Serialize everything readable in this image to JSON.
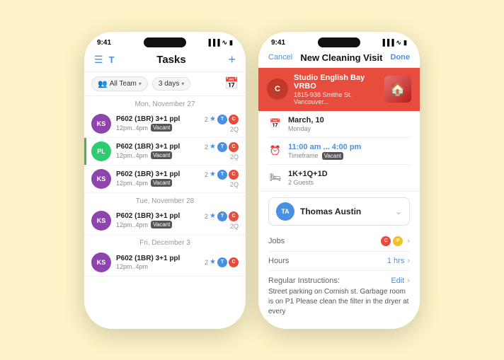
{
  "background": "#fdf3c8",
  "left_phone": {
    "status_time": "9:41",
    "header": {
      "title": "Tasks",
      "add_label": "+"
    },
    "filters": {
      "team_label": "All Team",
      "days_label": "3 days"
    },
    "sections": [
      {
        "date": "Mon, November 27",
        "tasks": [
          {
            "avatar": "KS",
            "avatar_class": "ks",
            "title": "P602 (1BR) 3+1 ppl",
            "time": "12pm..4pm",
            "badge": "Vacant",
            "count": "2",
            "count2": "2Q",
            "green_left": false
          },
          {
            "avatar": "PL",
            "avatar_class": "pl",
            "title": "P602 (1BR) 3+1 ppl",
            "time": "12pm..4pm",
            "badge": "Vacant",
            "count": "2",
            "count2": "2Q",
            "green_left": true
          },
          {
            "avatar": "KS",
            "avatar_class": "ks",
            "title": "P602 (1BR) 3+1 ppl",
            "time": "12pm..4pm",
            "badge": "Vacant",
            "count": "2",
            "count2": "2Q",
            "green_left": false
          }
        ]
      },
      {
        "date": "Tue, November 28",
        "tasks": [
          {
            "avatar": "KS",
            "avatar_class": "ks",
            "title": "P602 (1BR) 3+1 ppl",
            "time": "12pm..4pm",
            "badge": "Vacant",
            "count": "2",
            "count2": "2Q",
            "green_left": false
          }
        ]
      },
      {
        "date": "Fri, December 3",
        "tasks": [
          {
            "avatar": "KS",
            "avatar_class": "ks",
            "title": "P602 (1BR) 3+1 ppl",
            "time": "12pm..4pm",
            "badge": "",
            "count": "2",
            "count2": "",
            "green_left": false
          }
        ]
      }
    ]
  },
  "right_phone": {
    "status_time": "9:41",
    "header": {
      "cancel_label": "Cancel",
      "title": "New Cleaning Visit",
      "done_label": "Done"
    },
    "property": {
      "initial": "C",
      "name": "Studio English Bay VRBO",
      "address": "1815-938 Smithe St. Vancouver..."
    },
    "date": {
      "date_main": "March, 10",
      "date_sub": "Monday"
    },
    "time": {
      "time_main": "11:00 am ... 4:00 pm",
      "time_sub": "Timeframe",
      "time_badge": "Vacant"
    },
    "guests": {
      "guests_main": "1K+1Q+1D",
      "guests_sub": "2 Guests"
    },
    "assignee": {
      "initials": "TA",
      "name": "Thomas Austin"
    },
    "jobs": {
      "label": "Jobs",
      "value": ""
    },
    "hours": {
      "label": "Hours",
      "value": "1 hrs"
    },
    "instructions": {
      "label": "Regular Instructions:",
      "edit_label": "Edit",
      "text": "Street parking on Cornish st.\nGarbage room is on P1\nPlease  clean the filter in the dryer at every"
    }
  }
}
